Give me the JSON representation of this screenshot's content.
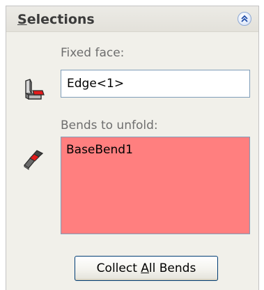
{
  "panel": {
    "title": "Selections",
    "collapse_icon": "double-chevron-up-icon"
  },
  "fixed_face": {
    "label": "Fixed face:",
    "icon": "fixed-face-icon",
    "value": "Edge<1>"
  },
  "bends": {
    "label": "Bends to unfold:",
    "icon": "sheet-metal-bend-icon",
    "items": [
      "BaseBend1"
    ],
    "highlight_color": "#ff7f7f"
  },
  "actions": {
    "collect_prefix": "Collect ",
    "collect_mnemonic": "A",
    "collect_suffix": "ll Bends"
  }
}
